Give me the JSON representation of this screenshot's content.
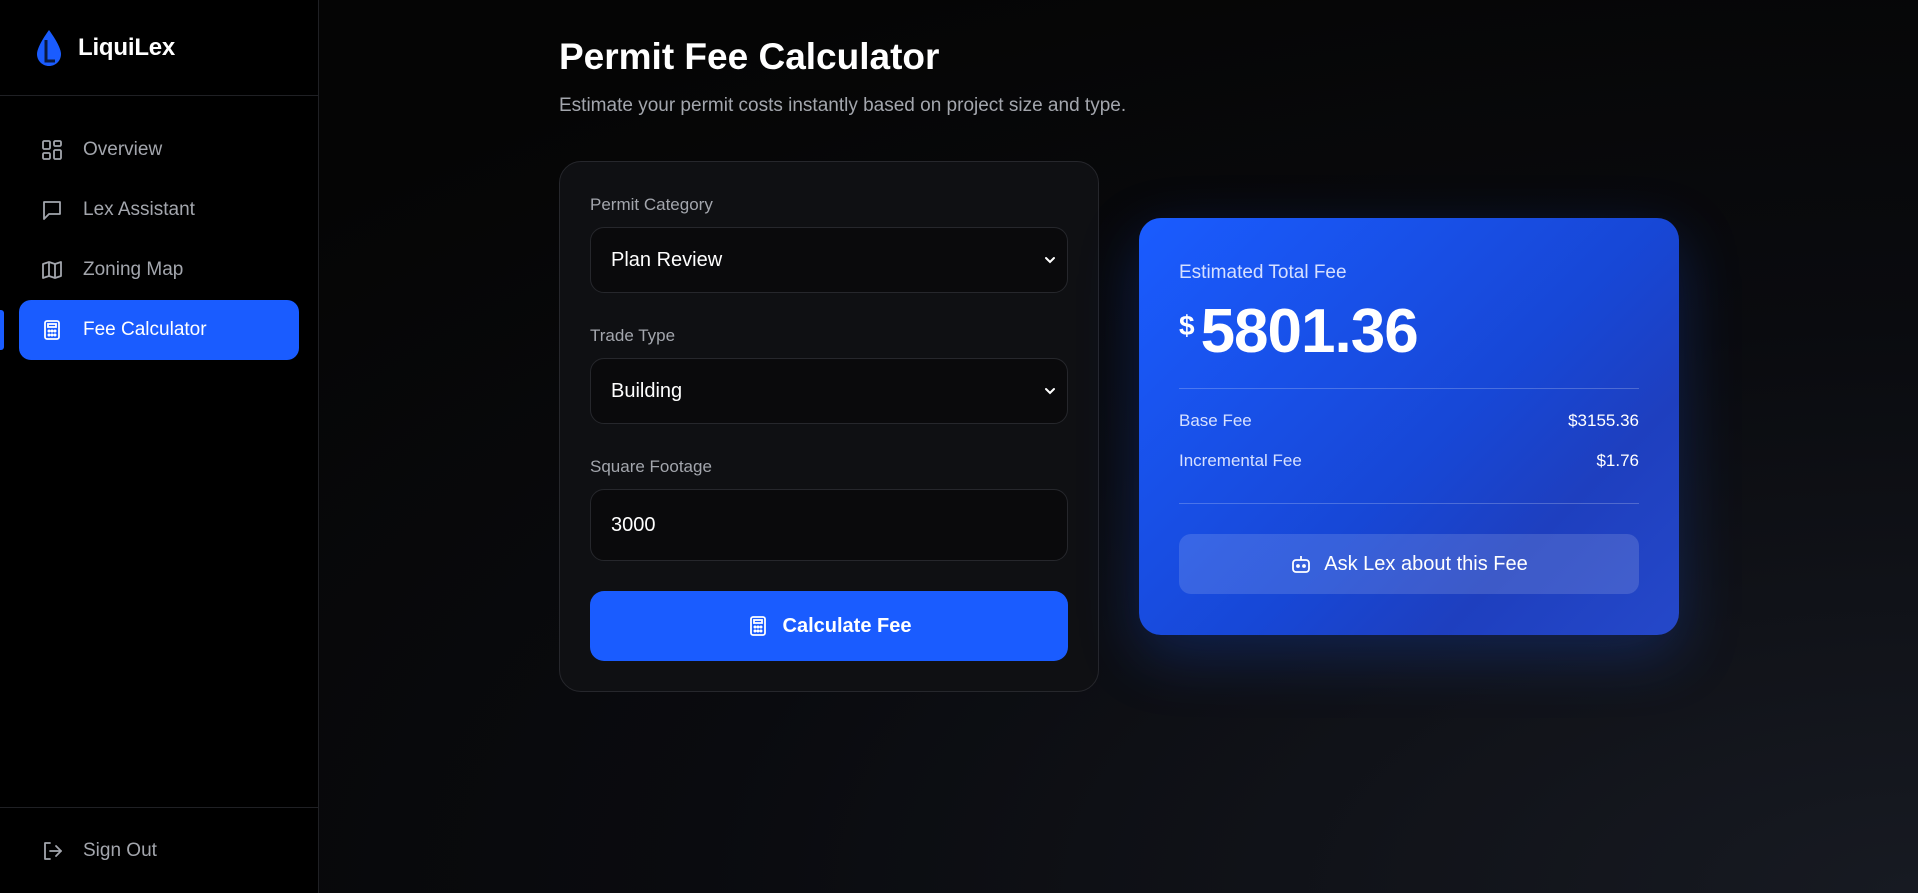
{
  "app": {
    "name": "LiquiLex",
    "logo_icon": "water-drop-icon"
  },
  "sidebar": {
    "items": [
      {
        "label": "Overview",
        "icon": "grid-icon",
        "active": false
      },
      {
        "label": "Lex Assistant",
        "icon": "chat-bubble-icon",
        "active": false
      },
      {
        "label": "Zoning Map",
        "icon": "map-icon",
        "active": false
      },
      {
        "label": "Fee Calculator",
        "icon": "calculator-icon",
        "active": true
      }
    ],
    "sign_out": {
      "label": "Sign Out",
      "icon": "logout-icon"
    }
  },
  "page": {
    "title": "Permit Fee Calculator",
    "subtitle": "Estimate your permit costs instantly based on project size and type."
  },
  "form": {
    "permit_category": {
      "label": "Permit Category",
      "value": "Plan Review"
    },
    "trade_type": {
      "label": "Trade Type",
      "value": "Building"
    },
    "square_footage": {
      "label": "Square Footage",
      "value": "3000"
    },
    "calculate_button": "Calculate Fee"
  },
  "result": {
    "label": "Estimated Total Fee",
    "currency": "$",
    "total": "5801.36",
    "base_fee": {
      "label": "Base Fee",
      "value": "$3155.36"
    },
    "incremental_fee": {
      "label": "Incremental Fee",
      "value": "$1.76"
    },
    "ask_button": "Ask Lex about this Fee"
  },
  "colors": {
    "accent": "#1a5cff",
    "sidebar_bg": "#000000",
    "card_bg": "#0f1013",
    "muted_text": "#a3a6ad"
  }
}
